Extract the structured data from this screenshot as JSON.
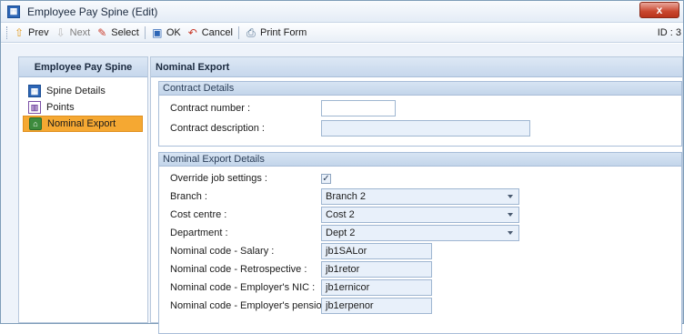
{
  "window": {
    "title": "Employee Pay Spine (Edit)",
    "close_glyph": "x",
    "app_icon": "spine-icon"
  },
  "toolbar": {
    "prev": "Prev",
    "next": "Next",
    "select": "Select",
    "ok": "OK",
    "cancel": "Cancel",
    "print": "Print Form",
    "id": "ID : 3"
  },
  "nav": {
    "header": "Employee Pay Spine",
    "items": [
      {
        "label": "Spine Details",
        "icon": "spine-details-icon"
      },
      {
        "label": "Points",
        "icon": "points-icon"
      },
      {
        "label": "Nominal Export",
        "icon": "nominal-export-icon",
        "active": true
      }
    ]
  },
  "content": {
    "header": "Nominal Export",
    "contract": {
      "title": "Contract Details",
      "number_label": "Contract number :",
      "number_value": "",
      "description_label": "Contract description :",
      "description_value": ""
    },
    "export": {
      "title": "Nominal Export Details",
      "override_label": "Override job settings :",
      "override_checked": true,
      "branch_label": "Branch :",
      "branch_value": "Branch 2",
      "cost_centre_label": "Cost centre :",
      "cost_centre_value": "Cost 2",
      "department_label": "Department :",
      "department_value": "Dept 2",
      "salary_label": "Nominal code - Salary :",
      "salary_value": "jb1SALor",
      "retro_label": "Nominal code - Retrospective :",
      "retro_value": "jb1retor",
      "nic_label": "Nominal code - Employer's NIC :",
      "nic_value": "jb1ernicor",
      "pension_label": "Nominal code - Employer's pension :",
      "pension_value": "jb1erpenor"
    }
  },
  "colors": {
    "active_nav": "#f5a832",
    "header_bg": "#c6d7ec",
    "accent": "#2d66b6"
  }
}
